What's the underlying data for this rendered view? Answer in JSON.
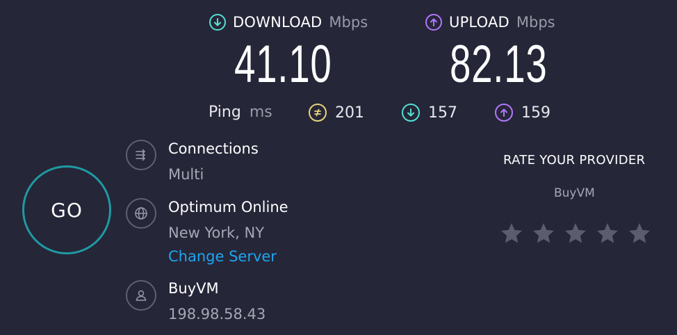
{
  "download": {
    "label": "DOWNLOAD",
    "unit": "Mbps",
    "value": "41.10"
  },
  "upload": {
    "label": "UPLOAD",
    "unit": "Mbps",
    "value": "82.13"
  },
  "ping": {
    "label": "Ping",
    "unit": "ms",
    "jitter": "201",
    "download": "157",
    "upload": "159"
  },
  "go": {
    "label": "GO"
  },
  "connections": {
    "title": "Connections",
    "value": "Multi"
  },
  "server": {
    "title": "Optimum Online",
    "location": "New York, NY",
    "change_label": "Change Server"
  },
  "host": {
    "title": "BuyVM",
    "ip": "198.98.58.43"
  },
  "rating": {
    "title": "RATE YOUR PROVIDER",
    "provider": "BuyVM",
    "stars": 5
  },
  "colors": {
    "background": "#252638",
    "download_accent": "#54e0d4",
    "upload_accent": "#b276ff",
    "jitter_accent": "#e8d47a",
    "go_ring": "#1f9aa3",
    "link": "#1ea4f0"
  }
}
